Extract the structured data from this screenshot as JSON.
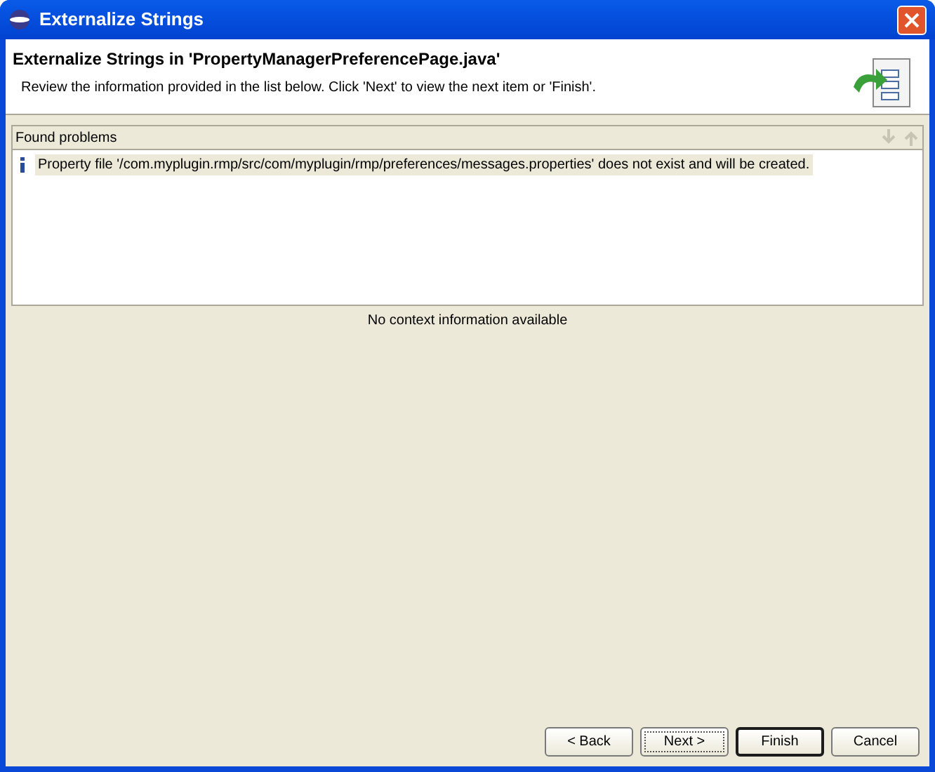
{
  "window": {
    "title": "Externalize Strings"
  },
  "header": {
    "title": "Externalize Strings in 'PropertyManagerPreferencePage.java'",
    "description": "Review the information provided in the list below. Click 'Next' to view the next item or 'Finish'."
  },
  "problems": {
    "title": "Found problems",
    "nav_buttons": [
      {
        "kind": "down",
        "disabled": true
      },
      {
        "kind": "up",
        "disabled": true
      }
    ],
    "items": [
      {
        "kind": "info",
        "text": "Property file '/com.myplugin.rmp/src/com/myplugin/rmp/preferences/messages.properties' does not exist and will be created.",
        "selected": true
      }
    ]
  },
  "context": "No context information available",
  "buttons": [
    {
      "label": "< Back",
      "focused": false,
      "default": false
    },
    {
      "label": "Next >",
      "focused": true,
      "default": false
    },
    {
      "label": "Finish",
      "focused": false,
      "default": true
    },
    {
      "label": "Cancel",
      "focused": false,
      "default": false
    }
  ]
}
